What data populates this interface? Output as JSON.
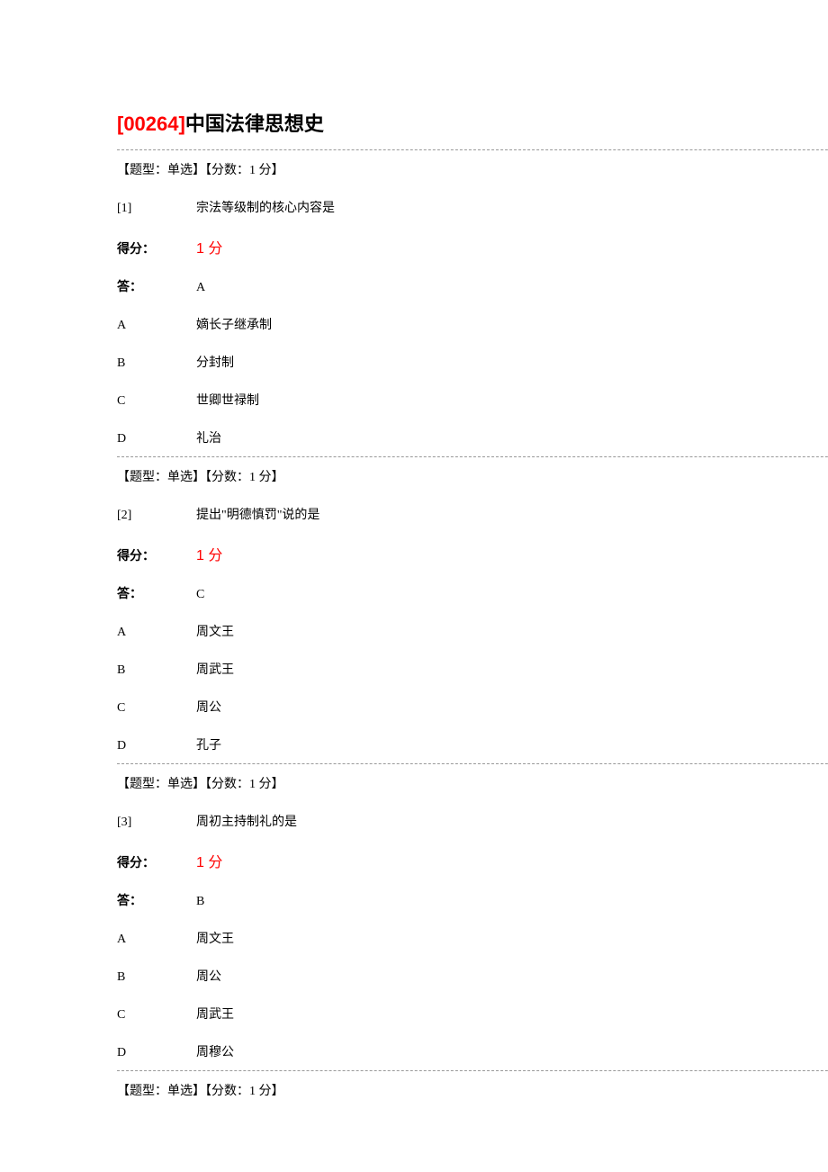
{
  "title": {
    "code": "[00264]",
    "text": "中国法律思想史"
  },
  "labels": {
    "score_label": "得分：",
    "answer_label": "答："
  },
  "questions": [
    {
      "meta": "【题型：单选】【分数：1 分】",
      "number": "[1]",
      "text": "宗法等级制的核心内容是",
      "score": "1 分",
      "answer": "A",
      "options": [
        {
          "key": "A",
          "text": "嫡长子继承制"
        },
        {
          "key": "B",
          "text": "分封制"
        },
        {
          "key": "C",
          "text": "世卿世禄制"
        },
        {
          "key": "D",
          "text": "礼治"
        }
      ]
    },
    {
      "meta": "【题型：单选】【分数：1 分】",
      "number": "[2]",
      "text": "提出\"明德慎罚\"说的是",
      "score": "1 分",
      "answer": "C",
      "options": [
        {
          "key": "A",
          "text": "周文王"
        },
        {
          "key": "B",
          "text": "周武王"
        },
        {
          "key": "C",
          "text": "周公"
        },
        {
          "key": "D",
          "text": "孔子"
        }
      ]
    },
    {
      "meta": "【题型：单选】【分数：1 分】",
      "number": "[3]",
      "text": "周初主持制礼的是",
      "score": "1 分",
      "answer": "B",
      "options": [
        {
          "key": "A",
          "text": "周文王"
        },
        {
          "key": "B",
          "text": "周公"
        },
        {
          "key": "C",
          "text": "周武王"
        },
        {
          "key": "D",
          "text": "周穆公"
        }
      ]
    },
    {
      "meta": "【题型：单选】【分数：1 分】"
    }
  ]
}
